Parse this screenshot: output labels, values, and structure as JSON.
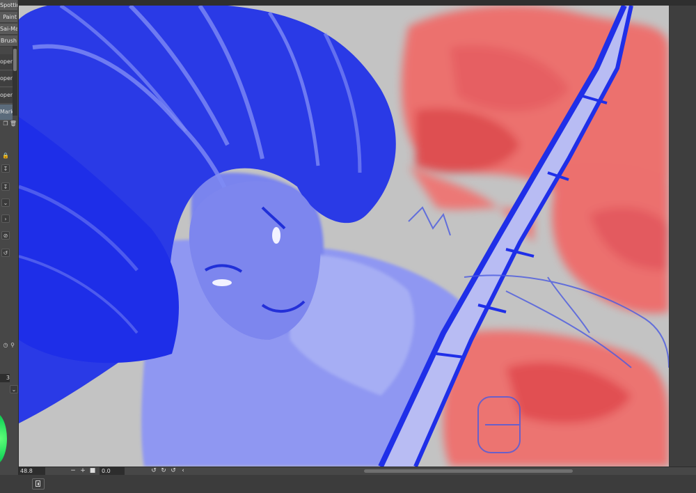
{
  "left_panel": {
    "tabs": [
      "Spotting",
      "Paint",
      "Sai-Marker",
      "Brush"
    ],
    "brush_items": [
      {
        "label": "open",
        "selected": false
      },
      {
        "label": "open",
        "selected": false
      },
      {
        "label": "open",
        "selected": false
      },
      {
        "label": "Marker",
        "selected": true
      }
    ],
    "size_value": "3"
  },
  "status_bar": {
    "zoom": "48.8",
    "rotation": "0.0"
  }
}
